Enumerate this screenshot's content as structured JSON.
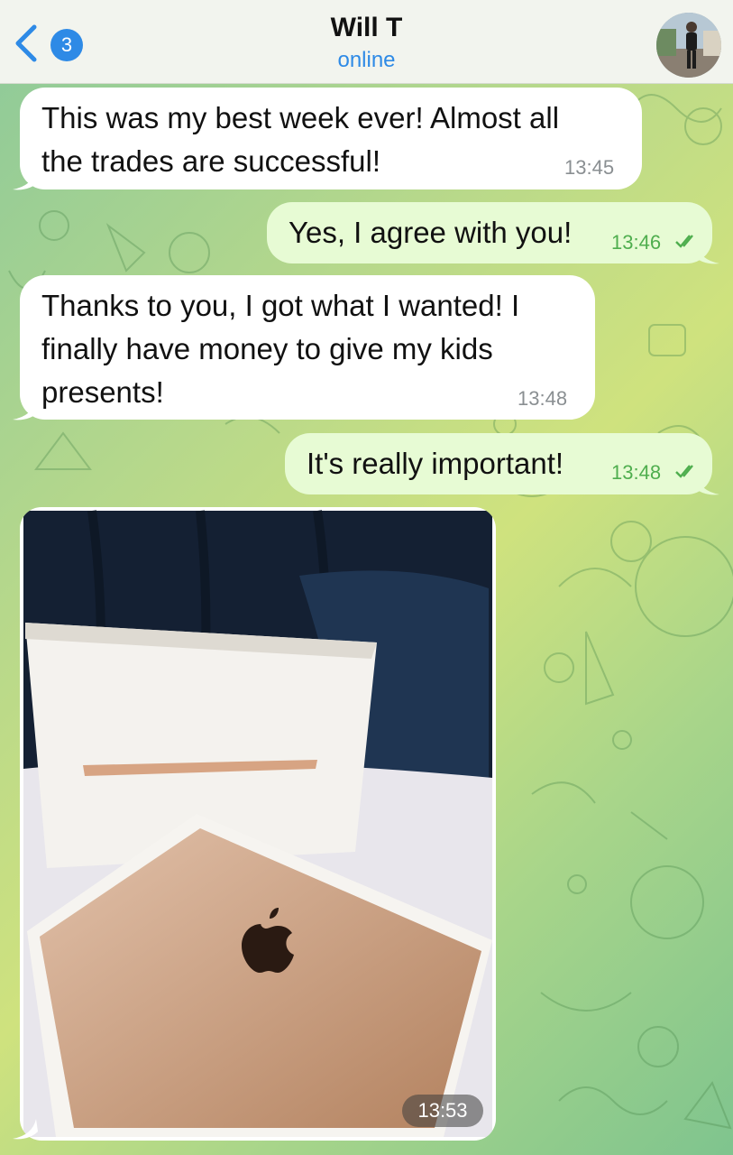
{
  "header": {
    "back_badge": "3",
    "contact_name": "Will T",
    "status": "online"
  },
  "messages": [
    {
      "direction": "incoming",
      "text": "This was my best week ever! Almost all\nthe trades are successful!",
      "time": "13:45"
    },
    {
      "direction": "outgoing",
      "text": "Yes, I agree with you!",
      "time": "13:46",
      "read": true
    },
    {
      "direction": "incoming",
      "text": "Thanks to you, I got what I wanted! I\nfinally have money to give my kids\npresents!",
      "time": "13:48"
    },
    {
      "direction": "outgoing",
      "text": "It's really important!",
      "time": "13:48",
      "read": true
    },
    {
      "direction": "incoming",
      "type": "photo",
      "photo_subject": "laptop-in-box-photo",
      "time": "13:53"
    }
  ],
  "colors": {
    "accent": "#2e8ae6",
    "incoming_bubble": "#ffffff",
    "outgoing_bubble": "#e7fbd4",
    "read_check": "#4fae4e"
  }
}
